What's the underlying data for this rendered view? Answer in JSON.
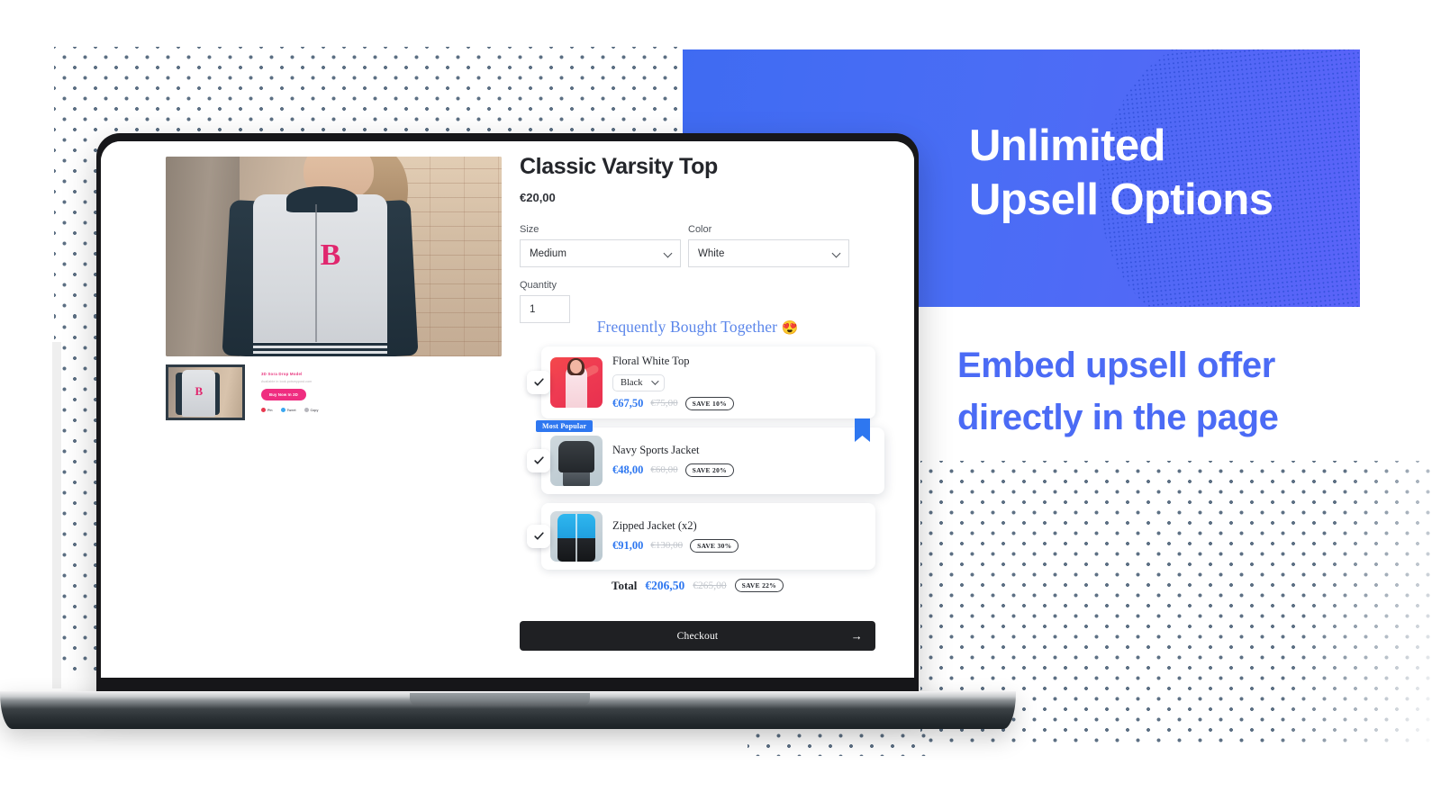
{
  "marketing": {
    "banner_line1": "Unlimited",
    "banner_line2": "Upsell Options",
    "banner_bg_color": "#4a6df5",
    "sub_headline": "Embed upsell offer directly in the page",
    "sub_headline_color": "#4b6bf5"
  },
  "store": {
    "product": {
      "title": "Classic Varsity Top",
      "price": "€20,00"
    },
    "options": [
      {
        "label": "Size",
        "value": "Medium"
      },
      {
        "label": "Color",
        "value": "White"
      }
    ],
    "quantity": {
      "label": "Quantity",
      "value": "1"
    },
    "thumbnail_preview": {
      "title": "3D Sora Drop Model",
      "subtitle": "Available in look.potsmypost.com",
      "cta": "Buy Now In 3D",
      "share": [
        "Pin",
        "Tweet",
        "Copy"
      ]
    }
  },
  "fbt": {
    "title": "Frequently Bought Together",
    "title_emoji": "😍",
    "title_color": "#5b86ea",
    "accent_color": "#2e77f0",
    "items": [
      {
        "name": "Floral White Top",
        "variant": "Black",
        "price": "€67,50",
        "compare_at": "€75,00",
        "save": "SAVE 10%",
        "checked": true,
        "badge": null,
        "ribbon": false
      },
      {
        "name": "Navy Sports Jacket",
        "variant": null,
        "price": "€48,00",
        "compare_at": "€60,00",
        "save": "SAVE 20%",
        "checked": true,
        "badge": "Most Popular",
        "ribbon": true
      },
      {
        "name": "Zipped Jacket (x2)",
        "variant": null,
        "price": "€91,00",
        "compare_at": "€130,00",
        "save": "SAVE 30%",
        "checked": true,
        "badge": null,
        "ribbon": false
      }
    ],
    "total": {
      "label": "Total",
      "price": "€206,50",
      "compare_at": "€265,00",
      "save": "SAVE 22%"
    },
    "checkout_label": "Checkout",
    "checkout_arrow": "→"
  }
}
